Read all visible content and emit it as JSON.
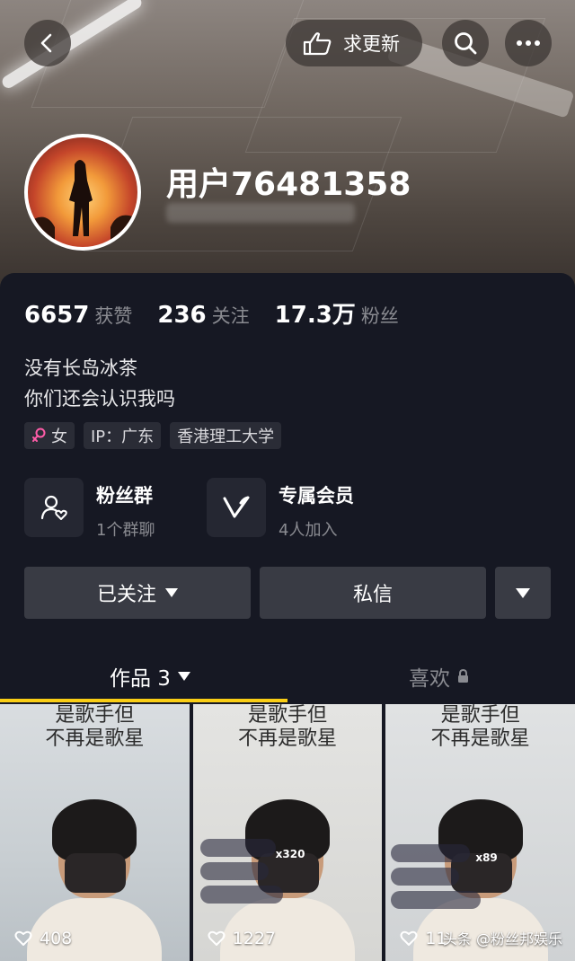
{
  "header": {
    "update_button_label": "求更新"
  },
  "profile": {
    "username": "用户76481358",
    "stats": [
      {
        "value": "6657",
        "label": "获赞"
      },
      {
        "value": "236",
        "label": "关注"
      },
      {
        "value": "17.3万",
        "label": "粉丝"
      }
    ],
    "bio_line1": "没有长岛冰茶",
    "bio_line2": "你们还会认识我吗",
    "tags": {
      "gender": "女",
      "ip": "IP：广东",
      "school": "香港理工大学"
    }
  },
  "features": {
    "fan_group_title": "粉丝群",
    "fan_group_sub": "1个群聊",
    "membership_title": "专属会员",
    "membership_sub": "4人加入"
  },
  "actions": {
    "follow_label": "已关注",
    "message_label": "私信"
  },
  "tabs": {
    "works_label": "作品 3",
    "likes_label": "喜欢"
  },
  "videos": [
    {
      "caption1": "是歌手但",
      "caption2": "不再是歌星",
      "likes": "408"
    },
    {
      "caption1": "是歌手但",
      "caption2": "不再是歌星",
      "likes": "1227",
      "overlay_count": "x320"
    },
    {
      "caption1": "是歌手但",
      "caption2": "不再是歌星",
      "likes": "11",
      "overlay_count": "x89"
    }
  ],
  "watermark": "头条 @粉丝邦娱乐",
  "colors": {
    "background": "#161823",
    "accent_underline": "#face15",
    "button_bg": "#393b44",
    "gender_icon": "#ff5ca8"
  }
}
